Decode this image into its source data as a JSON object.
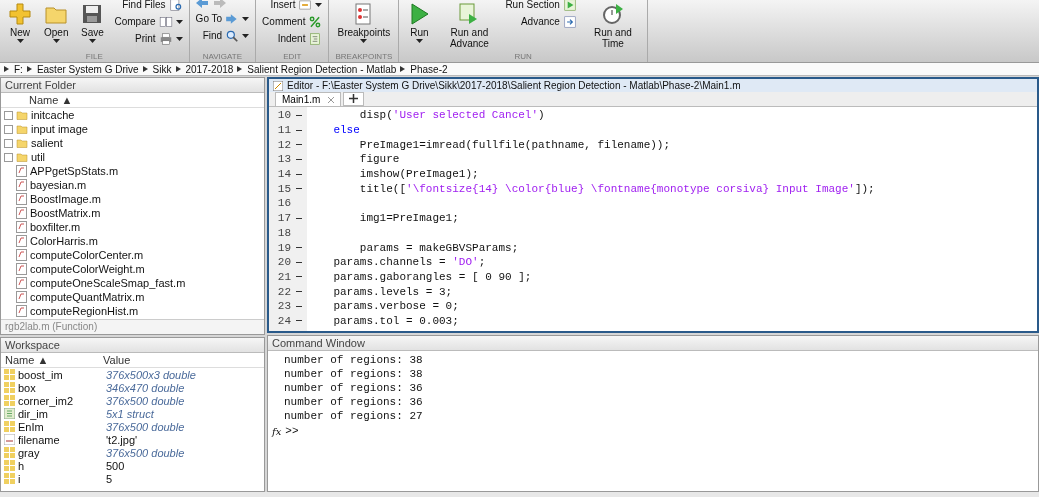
{
  "toolstrip": {
    "sections": [
      {
        "label": "FILE",
        "large": [
          {
            "label": "New",
            "menu": true
          },
          {
            "label": "Open",
            "menu": true
          },
          {
            "label": "Save",
            "menu": true
          }
        ],
        "small": [
          {
            "label": "Find Files",
            "menu": false
          },
          {
            "label": "Compare",
            "menu": true
          },
          {
            "label": "Print",
            "menu": true
          }
        ]
      },
      {
        "label": "NAVIGATE",
        "small": [
          {
            "label": "Go To",
            "menu": true
          },
          {
            "label": "Find",
            "menu": true
          }
        ]
      },
      {
        "label": "EDIT",
        "small": [
          {
            "label": "Insert",
            "menu": true
          },
          {
            "label": "Comment",
            "menu": false
          },
          {
            "label": "Indent",
            "menu": false
          }
        ]
      },
      {
        "label": "BREAKPOINTS",
        "large": [
          {
            "label": "Breakpoints",
            "menu": true
          }
        ]
      },
      {
        "label": "RUN",
        "large": [
          {
            "label": "Run",
            "menu": true
          },
          {
            "label": "Run and Advance",
            "menu": false
          }
        ],
        "small": [
          {
            "label": "Run Section",
            "menu": false
          },
          {
            "label": "Advance",
            "menu": false
          }
        ],
        "after": [
          {
            "label": "Run and Time",
            "menu": false
          }
        ]
      }
    ]
  },
  "address_bar": {
    "path": [
      "F:",
      "Easter System G Drive",
      "Sikk",
      "2017-2018",
      "Salient Region Detection - Matlab",
      "Phase-2"
    ]
  },
  "current_folder": {
    "title": "Current Folder",
    "column": "Name ▲",
    "items": [
      {
        "name": "initcache",
        "kind": "folder"
      },
      {
        "name": "input image",
        "kind": "folder"
      },
      {
        "name": "salient",
        "kind": "folder"
      },
      {
        "name": "util",
        "kind": "folder"
      },
      {
        "name": "APPgetSpStats.m",
        "kind": "file"
      },
      {
        "name": "bayesian.m",
        "kind": "file"
      },
      {
        "name": "BoostImage.m",
        "kind": "file"
      },
      {
        "name": "BoostMatrix.m",
        "kind": "file"
      },
      {
        "name": "boxfilter.m",
        "kind": "file"
      },
      {
        "name": "ColorHarris.m",
        "kind": "file"
      },
      {
        "name": "computeColorCenter.m",
        "kind": "file"
      },
      {
        "name": "computeColorWeight.m",
        "kind": "file"
      },
      {
        "name": "computeOneScaleSmap_fast.m",
        "kind": "file"
      },
      {
        "name": "computeQuantMatrix.m",
        "kind": "file"
      },
      {
        "name": "computeRegionHist.m",
        "kind": "file"
      }
    ],
    "details": "rgb2lab.m (Function)"
  },
  "workspace": {
    "title": "Workspace",
    "columns": [
      "Name ▲",
      "Value"
    ],
    "variables": [
      {
        "name": "boost_im",
        "value": "376x500x3 double",
        "kind": "matrix",
        "summary": true
      },
      {
        "name": "box",
        "value": "346x470 double",
        "kind": "matrix",
        "summary": true
      },
      {
        "name": "corner_im2",
        "value": "376x500 double",
        "kind": "matrix",
        "summary": true
      },
      {
        "name": "dir_im",
        "value": "5x1 struct",
        "kind": "struct",
        "summary": true
      },
      {
        "name": "EnIm",
        "value": "376x500 double",
        "kind": "matrix",
        "summary": true
      },
      {
        "name": "filename",
        "value": "'t2.jpg'",
        "kind": "char",
        "summary": false
      },
      {
        "name": "gray",
        "value": "376x500 double",
        "kind": "matrix",
        "summary": true
      },
      {
        "name": "h",
        "value": "500",
        "kind": "matrix",
        "summary": false
      },
      {
        "name": "i",
        "value": "5",
        "kind": "matrix",
        "summary": false
      }
    ]
  },
  "editor": {
    "title": "Editor - F:\\Easter System G Drive\\Sikk\\2017-2018\\Salient Region Detection - Matlab\\Phase-2\\Main1.m",
    "tabs": [
      {
        "label": "Main1.m",
        "selected": true
      }
    ],
    "lines": [
      {
        "number": "10",
        "executable": true,
        "segments": [
          {
            "kind": "code",
            "text": "        disp("
          },
          {
            "kind": "string",
            "text": "'User selected Cancel'"
          },
          {
            "kind": "code",
            "text": ")"
          }
        ]
      },
      {
        "number": "11",
        "executable": true,
        "segments": [
          {
            "kind": "keyword",
            "text": "    else"
          }
        ]
      },
      {
        "number": "12",
        "executable": true,
        "segments": [
          {
            "kind": "code",
            "text": "        PreImage1=imread(fullfile(pathname, filename));"
          }
        ]
      },
      {
        "number": "13",
        "executable": true,
        "segments": [
          {
            "kind": "code",
            "text": "        figure"
          }
        ]
      },
      {
        "number": "14",
        "executable": true,
        "segments": [
          {
            "kind": "code",
            "text": "        imshow(PreImage1);"
          }
        ]
      },
      {
        "number": "15",
        "executable": true,
        "segments": [
          {
            "kind": "code",
            "text": "        title(["
          },
          {
            "kind": "string",
            "text": "'\\fontsize{14} \\color{blue} \\fontname{monotype corsiva} Input Image'"
          },
          {
            "kind": "code",
            "text": "]);"
          }
        ]
      },
      {
        "number": "16",
        "executable": false
      },
      {
        "number": "17",
        "executable": true,
        "segments": [
          {
            "kind": "code",
            "text": "        img1=PreImage1;"
          }
        ]
      },
      {
        "number": "18",
        "executable": false
      },
      {
        "number": "19",
        "executable": true,
        "segments": [
          {
            "kind": "code",
            "text": "        params = makeGBVSParams;"
          }
        ]
      },
      {
        "number": "20",
        "executable": true,
        "segments": [
          {
            "kind": "code",
            "text": "    params.channels = "
          },
          {
            "kind": "string",
            "text": "'DO'"
          },
          {
            "kind": "code",
            "text": ";"
          }
        ]
      },
      {
        "number": "21",
        "executable": true,
        "segments": [
          {
            "kind": "code",
            "text": "    params.gaborangles = [ 0 90 ];"
          }
        ]
      },
      {
        "number": "22",
        "executable": true,
        "segments": [
          {
            "kind": "code",
            "text": "    params.levels = 3;"
          }
        ]
      },
      {
        "number": "23",
        "executable": true,
        "segments": [
          {
            "kind": "code",
            "text": "    params.verbose = 0;"
          }
        ]
      },
      {
        "number": "24",
        "executable": true,
        "segments": [
          {
            "kind": "code",
            "text": "    params.tol = 0.003;"
          }
        ]
      }
    ]
  },
  "command_window": {
    "title": "Command Window",
    "output": [
      "number of regions: 38",
      "number of regions: 38",
      "number of regions: 36",
      "number of regions: 36",
      "number of regions: 27"
    ],
    "prompt_symbol": "fx",
    "prompt": ">>"
  }
}
